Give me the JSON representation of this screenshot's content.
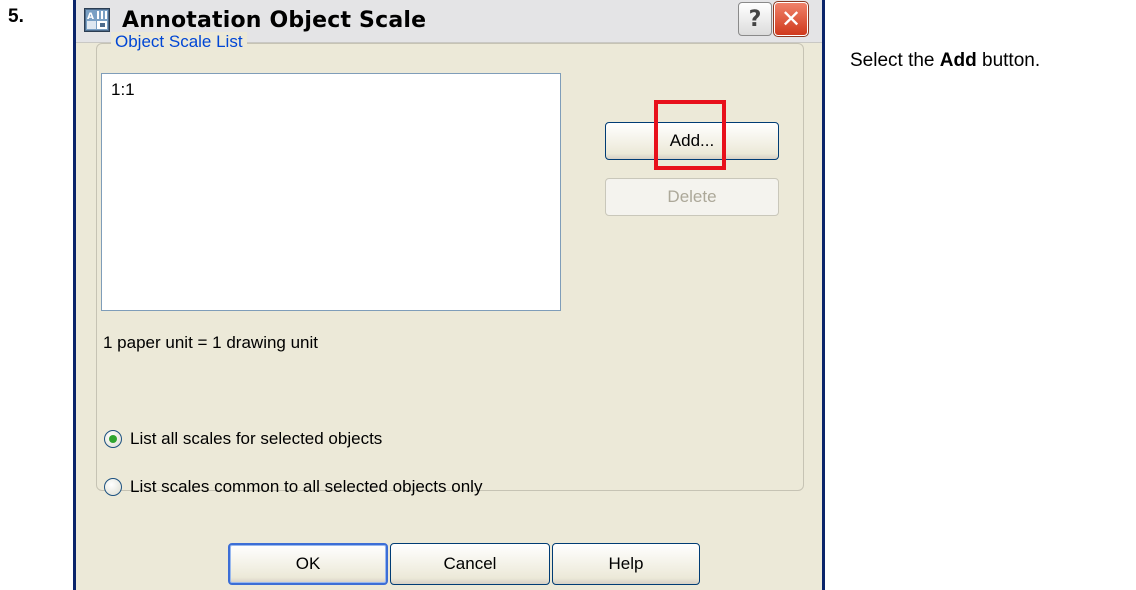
{
  "step": {
    "number": "5."
  },
  "instruction": {
    "prefix": "Select the ",
    "bold": "Add",
    "suffix": " button."
  },
  "dialog": {
    "title": "Annotation Object Scale",
    "help_glyph": "?",
    "close_glyph": "✕",
    "group_label": "Object Scale List",
    "list_items": [
      "1:1"
    ],
    "unit_text": "1 paper unit = 1 drawing unit",
    "buttons": {
      "add": "Add...",
      "delete": "Delete",
      "ok": "OK",
      "cancel": "Cancel",
      "help": "Help"
    },
    "radios": [
      {
        "label": "List all scales for selected objects",
        "checked": true
      },
      {
        "label": "List scales common to all selected objects only",
        "checked": false
      }
    ]
  },
  "colors": {
    "dialog_bg": "#ece9d8",
    "group_label": "#0046d5",
    "highlight": "#e8101c"
  }
}
